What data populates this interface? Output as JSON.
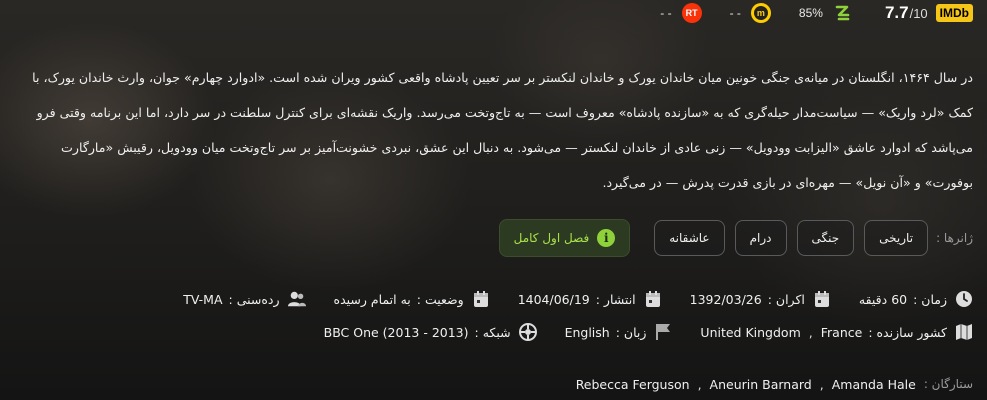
{
  "ratings": {
    "imdb": {
      "badge": "IMDb",
      "score": "7.7",
      "max": "/10"
    },
    "zoomg": {
      "icon": "zoomg-logo-icon",
      "value": "85%"
    },
    "metacritic": {
      "icon": "metacritic-icon",
      "value": "- -"
    },
    "rotten_tomatoes": {
      "icon": "rotten-tomatoes-icon",
      "value": "- -"
    }
  },
  "synopsis": "در سال ۱۴۶۴، انگلستان در میانه‌ی جنگی خونین میان خاندان یورک و خاندان لنکستر بر سر تعیین پادشاه واقعی کشور ویران شده است. «ادوارد چهارم» جوان، وارث خاندان یورک، با کمک «لرد واریک» — سیاست‌مدار حیله‌گری که به «سازنده پادشاه» معروف است — به تاج‌وتخت می‌رسد. واریک نقشه‌ای برای کنترل سلطنت در سر دارد، اما این برنامه وقتی فرو می‌پاشد که ادوارد عاشق «الیزابت وودویل» — زنی عادی از خاندان لنکستر — می‌شود. به دنبال این عشق، نبردی خشونت‌آمیز بر سر تاج‌وتخت میان وودویل، رقیبش «مارگارت بوفورت» و «آن نویل» — مهره‌ای در بازی قدرت پدرش — در می‌گیرد.",
  "genres": {
    "label": "ژانرها :",
    "items": [
      "تاریخی",
      "جنگی",
      "درام",
      "عاشقانه"
    ]
  },
  "season_button": {
    "label": "فصل اول کامل",
    "icon": "info-icon"
  },
  "meta": {
    "duration": {
      "label": "زمان :",
      "value": "60 دقیقه"
    },
    "release": {
      "label": "اکران :",
      "value": "1392/03/26"
    },
    "published": {
      "label": "انتشار :",
      "value": "1404/06/19"
    },
    "status": {
      "label": "وضعیت :",
      "value": "به اتمام رسیده"
    },
    "age_rating": {
      "label": "رده‌سنی :",
      "value": "TV-MA"
    }
  },
  "production": {
    "country_label": "کشور سازنده :",
    "countries": [
      "France",
      "United Kingdom"
    ],
    "language_label": "زبان :",
    "language": "English",
    "network_label": "شبکه :",
    "network": "BBC One (2013 - 2013)"
  },
  "cast": {
    "label": "ستارگان :",
    "names": [
      "Amanda Hale",
      "Aneurin Barnard",
      "Rebecca Ferguson"
    ]
  },
  "colors": {
    "accent_green": "#8fd13b",
    "imdb_yellow": "#f5c518",
    "rt_red": "#fa320a"
  }
}
